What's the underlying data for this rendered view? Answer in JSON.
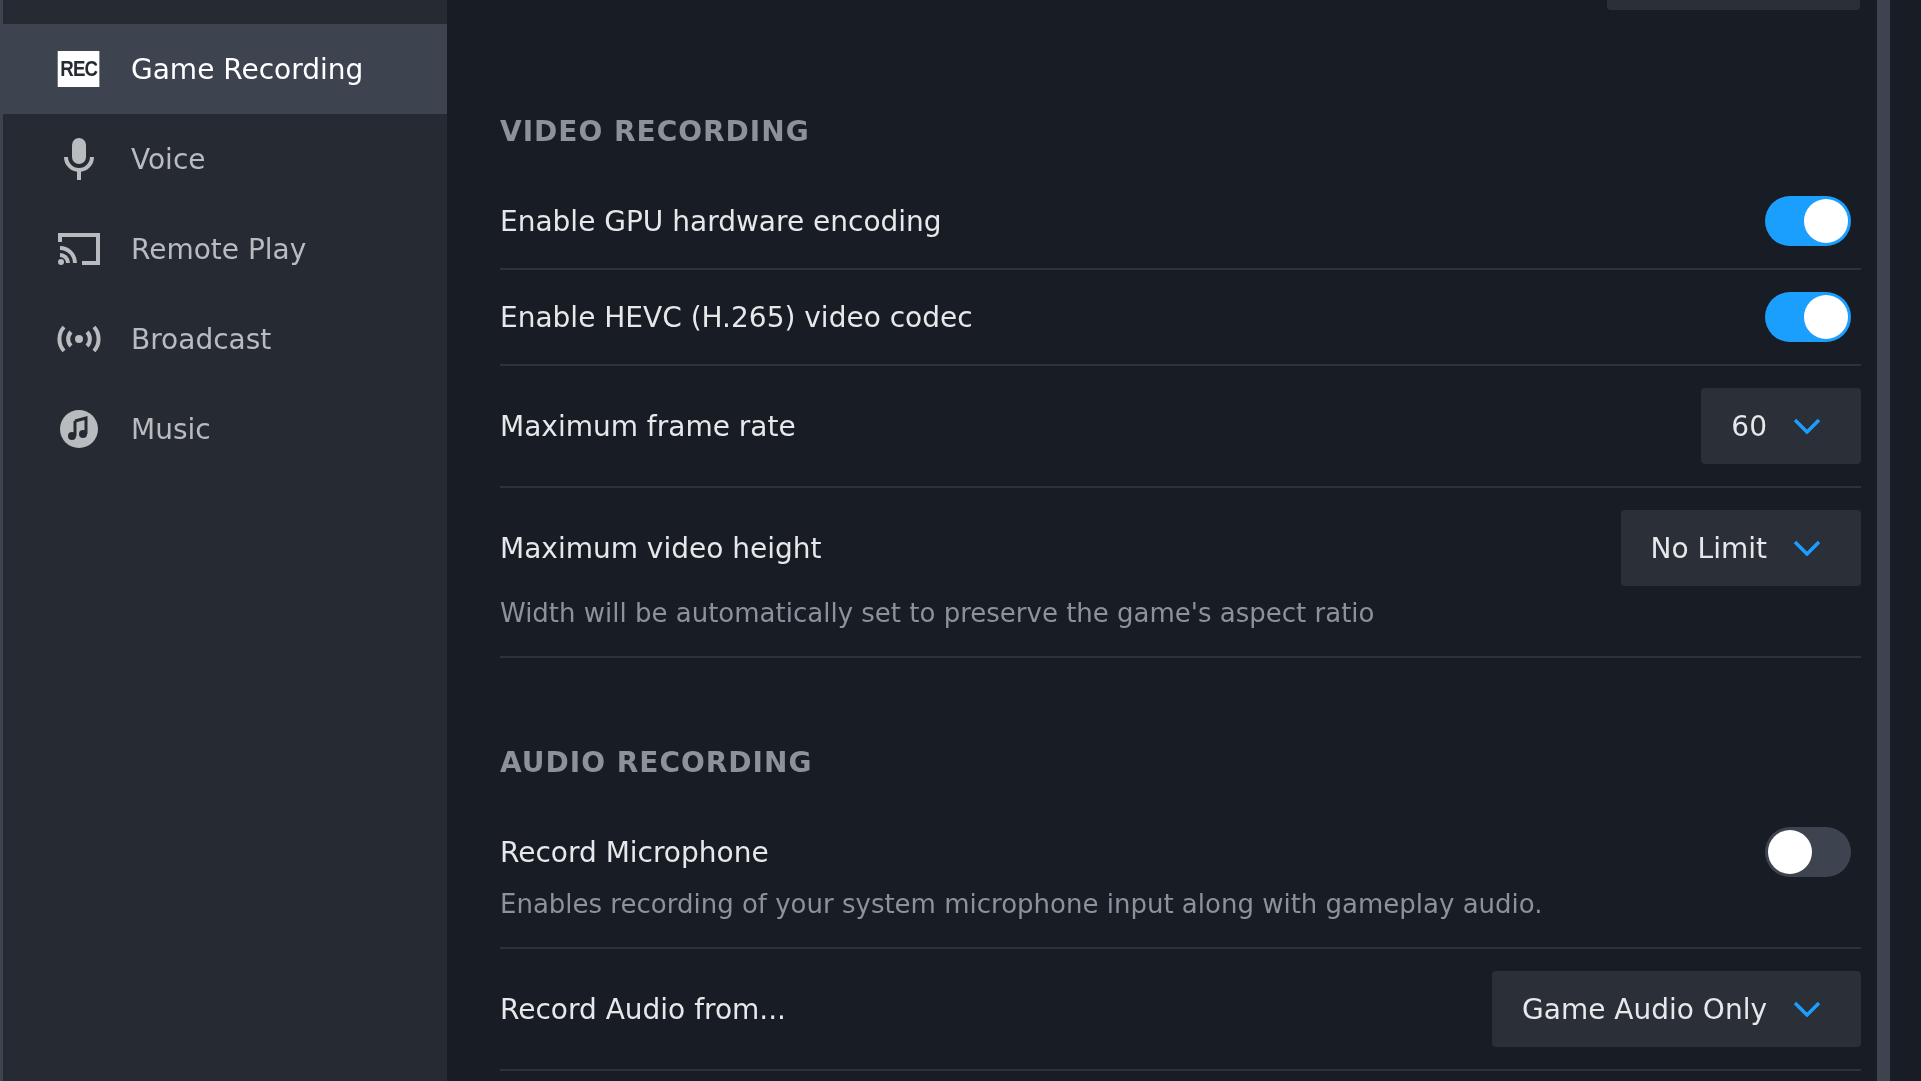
{
  "sidebar": {
    "items": [
      {
        "label": "Game Recording",
        "icon_text": "REC",
        "selected": true
      },
      {
        "label": "Voice",
        "selected": false
      },
      {
        "label": "Remote Play",
        "selected": false
      },
      {
        "label": "Broadcast",
        "selected": false
      },
      {
        "label": "Music",
        "selected": false
      }
    ]
  },
  "sections": [
    {
      "title": "VIDEO RECORDING",
      "rows": [
        {
          "kind": "toggle",
          "label": "Enable GPU hardware encoding",
          "on": true
        },
        {
          "kind": "toggle",
          "label": "Enable HEVC (H.265) video codec",
          "on": true
        },
        {
          "kind": "dropdown",
          "label": "Maximum frame rate",
          "value": "60"
        },
        {
          "kind": "dropdown",
          "label": "Maximum video height",
          "value": "No Limit",
          "description": "Width will be automatically set to preserve the game's aspect ratio"
        }
      ]
    },
    {
      "title": "AUDIO RECORDING",
      "rows": [
        {
          "kind": "toggle",
          "label": "Record Microphone",
          "on": false,
          "description": "Enables recording of your system microphone input along with gameplay audio."
        },
        {
          "kind": "dropdown",
          "label": "Record Audio from...",
          "value": "Game Audio Only"
        }
      ]
    }
  ]
}
